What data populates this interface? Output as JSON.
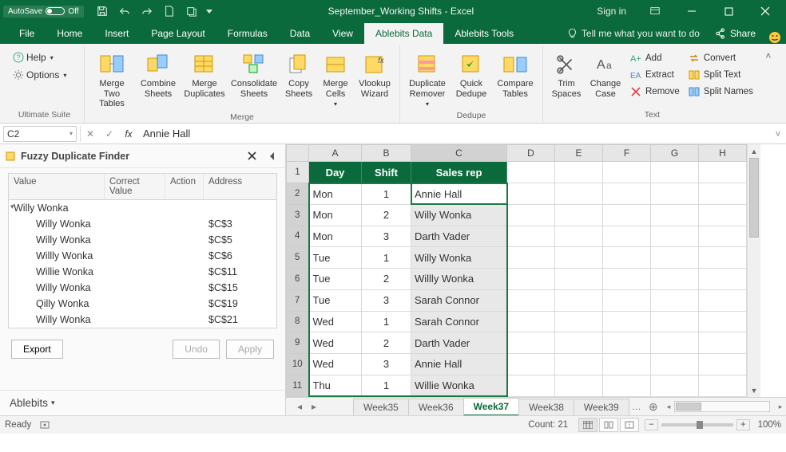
{
  "titlebar": {
    "autosave_label": "AutoSave",
    "autosave_state": "Off",
    "title": "September_Working Shifts - Excel",
    "signin": "Sign in"
  },
  "tabs": {
    "items": [
      "File",
      "Home",
      "Insert",
      "Page Layout",
      "Formulas",
      "Data",
      "View",
      "Ablebits Data",
      "Ablebits Tools"
    ],
    "active": 7,
    "tellme": "Tell me what you want to do",
    "share": "Share"
  },
  "ribbon": {
    "help": "Help",
    "options": "Options",
    "suite_label": "Ultimate Suite",
    "merge": {
      "merge_two": "Merge\nTwo Tables",
      "combine": "Combine\nSheets",
      "merge_dup": "Merge\nDuplicates",
      "consolidate": "Consolidate\nSheets",
      "copy": "Copy\nSheets",
      "merge_cells": "Merge\nCells",
      "vlookup": "Vlookup\nWizard",
      "label": "Merge"
    },
    "dedupe": {
      "dup_remover": "Duplicate\nRemover",
      "quick": "Quick\nDedupe",
      "compare": "Compare\nTables",
      "label": "Dedupe"
    },
    "text": {
      "trim": "Trim\nSpaces",
      "case": "Change\nCase",
      "add": "Add",
      "extract": "Extract",
      "remove": "Remove",
      "convert": "Convert",
      "split_text": "Split Text",
      "split_names": "Split Names",
      "label": "Text"
    }
  },
  "formula_bar": {
    "namebox": "C2",
    "formula": "Annie Hall"
  },
  "pane": {
    "title": "Fuzzy Duplicate Finder",
    "columns": [
      "Value",
      "Correct Value",
      "Action",
      "Address"
    ],
    "parent": "Willy Wonka",
    "rows": [
      {
        "value": "Willy Wonka",
        "address": "$C$3"
      },
      {
        "value": "Willy Wonka",
        "address": "$C$5"
      },
      {
        "value": "Willly Wonka",
        "address": "$C$6"
      },
      {
        "value": "Willie Wonka",
        "address": "$C$11"
      },
      {
        "value": "Willy Wonka",
        "address": "$C$15"
      },
      {
        "value": "Qilly Wonka",
        "address": "$C$19"
      },
      {
        "value": "Willy Wonka",
        "address": "$C$21"
      }
    ],
    "export": "Export",
    "undo": "Undo",
    "apply": "Apply",
    "footer": "Ablebits"
  },
  "sheet": {
    "col_labels": [
      "A",
      "B",
      "C",
      "D",
      "E",
      "F",
      "G",
      "H"
    ],
    "headers": {
      "a": "Day",
      "b": "Shift",
      "c": "Sales rep"
    },
    "rows": [
      {
        "n": 2,
        "a": "Mon",
        "b": "1",
        "c": "Annie Hall"
      },
      {
        "n": 3,
        "a": "Mon",
        "b": "2",
        "c": "Willy Wonka"
      },
      {
        "n": 4,
        "a": "Mon",
        "b": "3",
        "c": "Darth Vader"
      },
      {
        "n": 5,
        "a": "Tue",
        "b": "1",
        "c": "Willy Wonka"
      },
      {
        "n": 6,
        "a": "Tue",
        "b": "2",
        "c": "Willly Wonka"
      },
      {
        "n": 7,
        "a": "Tue",
        "b": "3",
        "c": "Sarah Connor"
      },
      {
        "n": 8,
        "a": "Wed",
        "b": "1",
        "c": "Sarah Connor"
      },
      {
        "n": 9,
        "a": "Wed",
        "b": "2",
        "c": "Darth Vader"
      },
      {
        "n": 10,
        "a": "Wed",
        "b": "3",
        "c": "Annie Hall"
      },
      {
        "n": 11,
        "a": "Thu",
        "b": "1",
        "c": "Willie Wonka"
      }
    ],
    "tabs": [
      "Week35",
      "Week36",
      "Week37",
      "Week38",
      "Week39"
    ],
    "active_tab": 2
  },
  "status": {
    "ready": "Ready",
    "count": "Count: 21",
    "zoom": "100%"
  }
}
